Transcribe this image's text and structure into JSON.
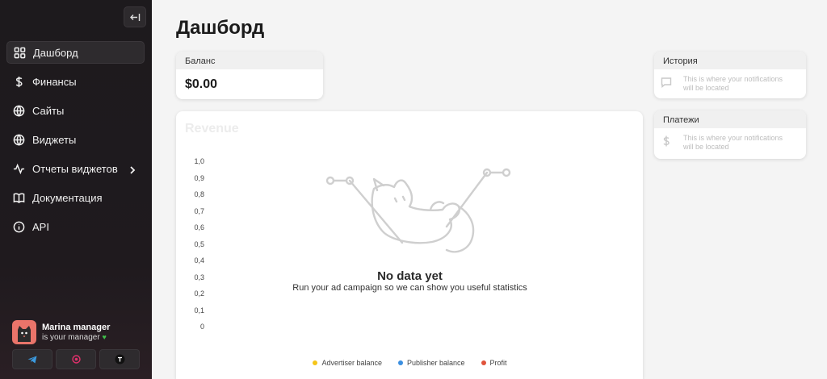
{
  "sidebar": {
    "items": [
      {
        "label": "Дашборд",
        "icon": "dashboard-icon",
        "active": true
      },
      {
        "label": "Финансы",
        "icon": "dollar-icon"
      },
      {
        "label": "Сайты",
        "icon": "globe-icon"
      },
      {
        "label": "Виджеты",
        "icon": "globe-icon"
      },
      {
        "label": "Отчеты виджетов",
        "icon": "activity-icon",
        "has_submenu": true
      },
      {
        "label": "Документация",
        "icon": "book-icon"
      },
      {
        "label": "API",
        "icon": "info-icon"
      }
    ],
    "manager": {
      "name": "Marina manager",
      "subtitle": "is your manager",
      "heart": "♥"
    },
    "socials": [
      "telegram-icon",
      "at-icon",
      "tenchat-icon"
    ]
  },
  "page": {
    "title": "Дашборд"
  },
  "balance": {
    "label": "Баланс",
    "value": "$0.00"
  },
  "history": {
    "label": "История",
    "empty_text": "This is where your notifications will be located"
  },
  "payments": {
    "label": "Платежи",
    "empty_text": "This is where your notifications will be located"
  },
  "revenue": {
    "title": "Revenue",
    "empty_title": "No data yet",
    "empty_subtitle": "Run your ad campaign so we can show you useful statistics"
  },
  "chart_data": {
    "type": "line",
    "title": "Revenue",
    "y_ticks": [
      "1,0",
      "0,9",
      "0,8",
      "0,7",
      "0,6",
      "0,5",
      "0,4",
      "0,3",
      "0,2",
      "0,1",
      "0"
    ],
    "ylim": [
      0,
      1
    ],
    "series": [
      {
        "name": "Advertiser balance",
        "color": "#f5c518",
        "values": []
      },
      {
        "name": "Publisher balance",
        "color": "#3b8fe0",
        "values": []
      },
      {
        "name": "Profit",
        "color": "#e0533b",
        "values": []
      }
    ]
  }
}
